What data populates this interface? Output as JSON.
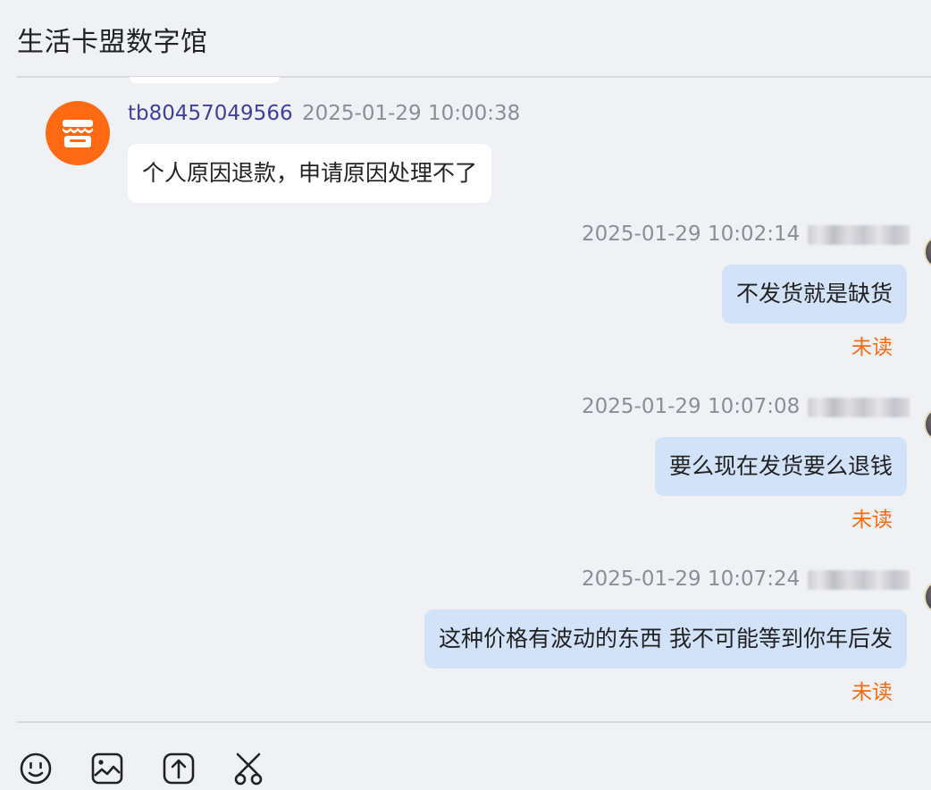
{
  "header": {
    "title": "生活卡盟数字馆"
  },
  "messages": [
    {
      "direction": "incoming",
      "sender": "tb80457049566",
      "time": "2025-01-29 10:00:38",
      "text": "个人原因退款，申请原因处理不了"
    },
    {
      "direction": "outgoing",
      "time": "2025-01-29 10:02:14",
      "text": "不发货就是缺货",
      "status": "未读"
    },
    {
      "direction": "outgoing",
      "time": "2025-01-29 10:07:08",
      "text": "要么现在发货要么退钱",
      "status": "未读"
    },
    {
      "direction": "outgoing",
      "time": "2025-01-29 10:07:24",
      "text": "这种价格有波动的东西 我不可能等到你年后发",
      "status": "未读"
    }
  ],
  "toolbar": {
    "icons": [
      "emoji-icon",
      "image-icon",
      "upload-icon",
      "scissors-icon"
    ]
  },
  "colors": {
    "background": "#f0f1f5",
    "incoming_bubble": "#ffffff",
    "outgoing_bubble": "#d2e2f9",
    "sender_name": "#3f3f9c",
    "unread": "#f46b12",
    "shop_avatar": "#ff6a13"
  }
}
